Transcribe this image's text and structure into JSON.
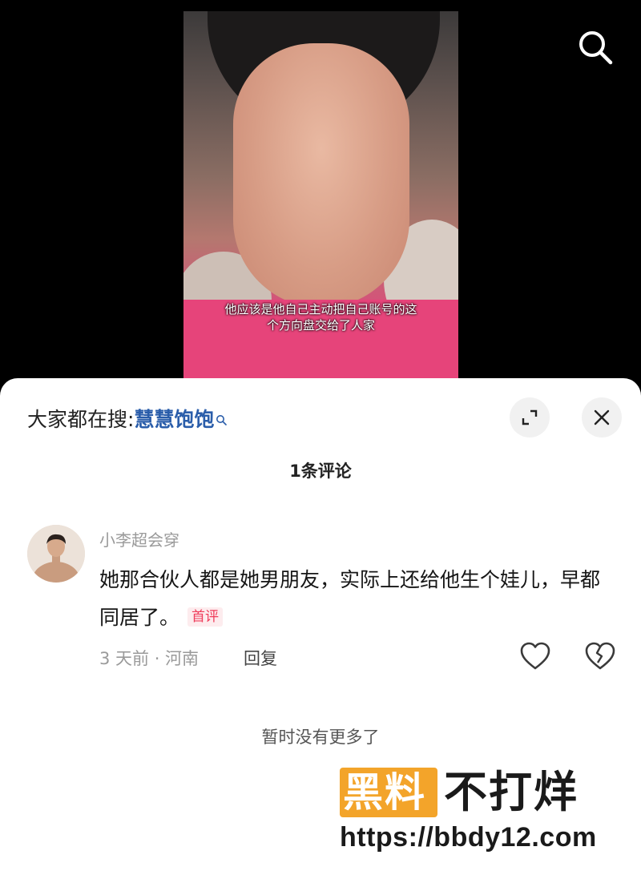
{
  "video": {
    "subtitle_line1": "他应该是他自己主动把自己账号的这",
    "subtitle_line2": "个方向盘交给了人家"
  },
  "icons": {
    "search": "search-icon",
    "expand": "expand-icon",
    "close": "close-icon",
    "like": "heart-icon",
    "dislike": "broken-heart-icon"
  },
  "sheet": {
    "search_prefix": "大家都在搜:",
    "search_keyword": "慧慧饱饱",
    "comment_count": "1条评论"
  },
  "comments": [
    {
      "username": "小李超会穿",
      "text": "她那合伙人都是她男朋友，实际上还给他生个娃儿，早都同居了。",
      "badge": "首评",
      "time_location": "3 天前 · 河南",
      "reply_label": "回复"
    }
  ],
  "footer": {
    "no_more": "暂时没有更多了"
  },
  "watermark": {
    "highlight": "黑料",
    "rest": "不打烊",
    "url": "https://bbdy12.com"
  },
  "colors": {
    "keyword": "#2a5daa",
    "badge": "#ef3c5a",
    "watermark_orange": "#f3a42a"
  }
}
